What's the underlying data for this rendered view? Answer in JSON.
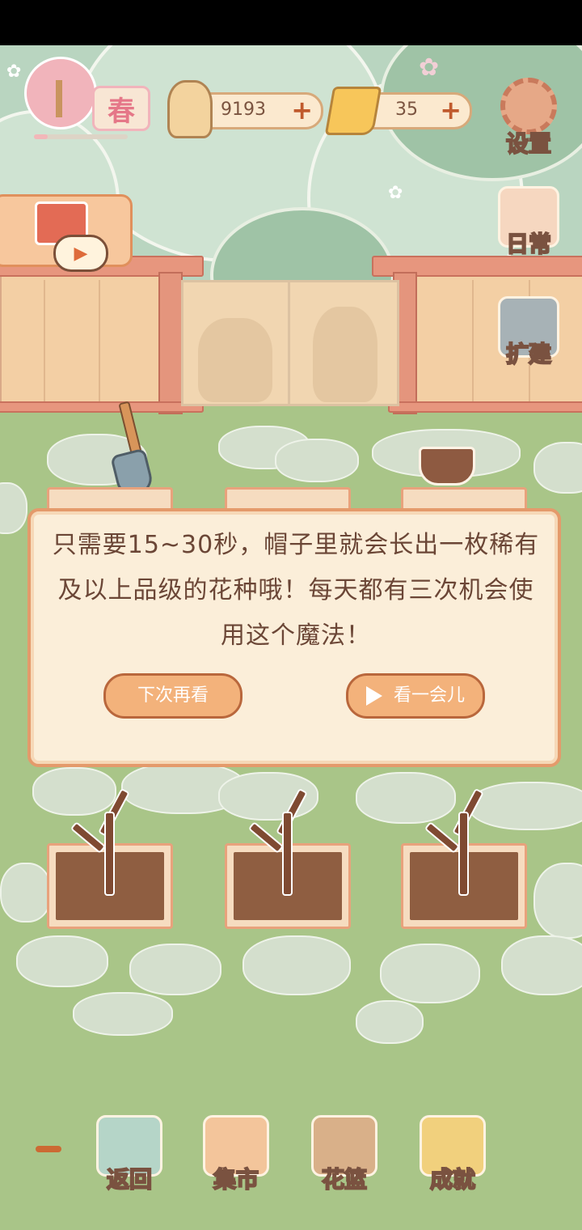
{
  "hud": {
    "season": "春",
    "season_progress": 0.15,
    "fish_count": "9193",
    "cheese_count": "35",
    "plus": "+"
  },
  "side_menu": {
    "settings": "设置",
    "daily": "日常",
    "build": "扩建"
  },
  "dialog": {
    "message": "只需要15~30秒，帽子里就会长出一枚稀有及以上品级的花种哦！每天都有三次机会使用这个魔法！",
    "later": "下次再看",
    "watch": "看一会儿"
  },
  "bottom_nav": {
    "back": "返回",
    "market": "集市",
    "basket": "花篮",
    "achievements": "成就"
  },
  "icons": {
    "play": "play-icon",
    "fish": "fish-bone-icon",
    "cheese": "cheese-icon",
    "gear": "gear-icon",
    "watering_can": "watering-can-icon",
    "shovel": "shovel-icon",
    "pot": "flower-pot-icon"
  },
  "colors": {
    "accent": "#e49a6b",
    "text": "#6b4636",
    "grass": "#a9c588"
  }
}
